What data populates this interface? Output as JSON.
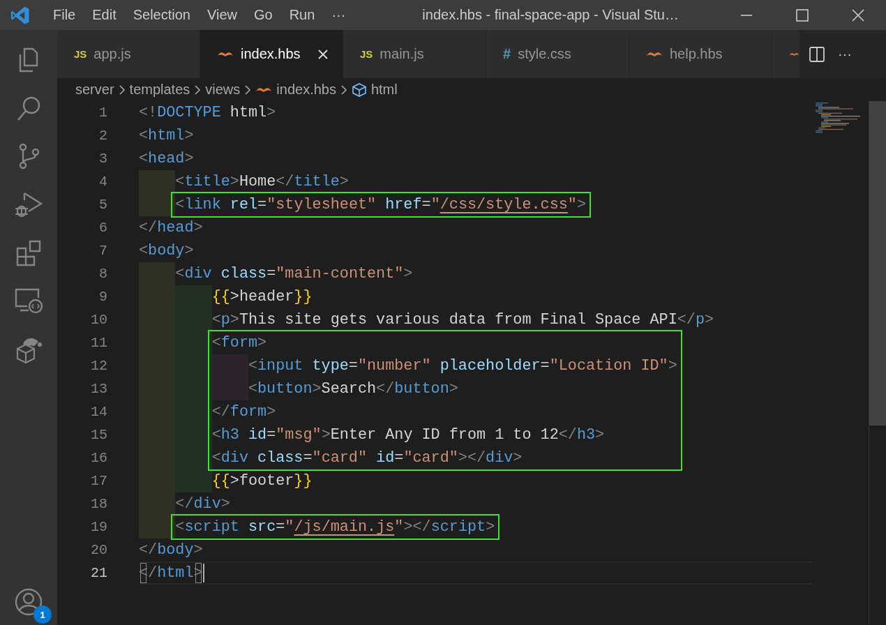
{
  "title_bar": {
    "menu": [
      "File",
      "Edit",
      "Selection",
      "View",
      "Go",
      "Run",
      "···"
    ],
    "title": "index.hbs - final-space-app - Visual Stu…"
  },
  "activity_bar": {
    "account_badge": "1"
  },
  "tabs": [
    {
      "kind": "js",
      "icon_text": "JS",
      "label": "app.js",
      "selected": false
    },
    {
      "kind": "hbs",
      "label": "index.hbs",
      "selected": true
    },
    {
      "kind": "js",
      "icon_text": "JS",
      "label": "main.js",
      "selected": false
    },
    {
      "kind": "css",
      "icon_text": "#",
      "label": "style.css",
      "selected": false
    },
    {
      "kind": "hbs",
      "label": "help.hbs",
      "selected": false
    },
    {
      "kind": "hbs",
      "selected": false
    }
  ],
  "tab_actions": {
    "more": "···"
  },
  "breadcrumbs": [
    {
      "kind": "folder",
      "label": "server"
    },
    {
      "kind": "folder",
      "label": "templates"
    },
    {
      "kind": "folder",
      "label": "views"
    },
    {
      "kind": "hbs",
      "label": "index.hbs"
    },
    {
      "kind": "element",
      "label": "html"
    }
  ],
  "code": [
    {
      "kind": "line",
      "number": "1",
      "current": false,
      "tokens": [
        {
          "kind": "punct",
          "text": "<!"
        },
        {
          "kind": "tag",
          "text": "DOCTYPE"
        },
        {
          "kind": "text",
          "text": " html"
        },
        {
          "kind": "punct",
          "text": ">"
        }
      ]
    },
    {
      "kind": "line",
      "number": "2",
      "current": false,
      "tokens": [
        {
          "kind": "punct",
          "text": "<"
        },
        {
          "kind": "tag",
          "text": "html"
        },
        {
          "kind": "punct",
          "text": ">"
        }
      ]
    },
    {
      "kind": "line",
      "number": "3",
      "current": false,
      "tokens": [
        {
          "kind": "punct",
          "text": "<"
        },
        {
          "kind": "tag",
          "text": "head"
        },
        {
          "kind": "punct",
          "text": ">"
        }
      ]
    },
    {
      "kind": "line",
      "number": "4",
      "current": false,
      "tokens": [
        {
          "kind": "punct",
          "text": "    <"
        },
        {
          "kind": "tag",
          "text": "title"
        },
        {
          "kind": "punct",
          "text": ">"
        },
        {
          "kind": "text",
          "text": "Home"
        },
        {
          "kind": "punct",
          "text": "</"
        },
        {
          "kind": "tag",
          "text": "title"
        },
        {
          "kind": "punct",
          "text": ">"
        }
      ]
    },
    {
      "kind": "box",
      "lines": [
        {
          "kind": "line",
          "number": "5",
          "current": false,
          "tokens": [
            {
              "kind": "punct",
              "text": "    <"
            },
            {
              "kind": "tag",
              "text": "link"
            },
            {
              "kind": "attr",
              "text": " rel"
            },
            {
              "kind": "text",
              "text": "="
            },
            {
              "kind": "str",
              "text": "\"stylesheet\""
            },
            {
              "kind": "attr",
              "text": " href"
            },
            {
              "kind": "text",
              "text": "="
            },
            {
              "kind": "str",
              "text": "\""
            },
            {
              "kind": "link",
              "text": "/css/style.css"
            },
            {
              "kind": "str",
              "text": "\""
            },
            {
              "kind": "punct",
              "text": ">"
            }
          ]
        }
      ]
    },
    {
      "kind": "line",
      "number": "6",
      "current": false,
      "tokens": [
        {
          "kind": "punct",
          "text": "</"
        },
        {
          "kind": "tag",
          "text": "head"
        },
        {
          "kind": "punct",
          "text": ">"
        }
      ]
    },
    {
      "kind": "line",
      "number": "7",
      "current": false,
      "tokens": [
        {
          "kind": "punct",
          "text": "<"
        },
        {
          "kind": "tag",
          "text": "body"
        },
        {
          "kind": "punct",
          "text": ">"
        }
      ]
    },
    {
      "kind": "line",
      "number": "8",
      "current": false,
      "tokens": [
        {
          "kind": "punct",
          "text": "    <"
        },
        {
          "kind": "tag",
          "text": "div"
        },
        {
          "kind": "attr",
          "text": " class"
        },
        {
          "kind": "text",
          "text": "="
        },
        {
          "kind": "str",
          "text": "\"main-content\""
        },
        {
          "kind": "punct",
          "text": ">"
        }
      ]
    },
    {
      "kind": "line",
      "number": "9",
      "current": false,
      "tokens": [
        {
          "kind": "hbs",
          "text": "        {{"
        },
        {
          "kind": "text",
          "text": ">header"
        },
        {
          "kind": "hbs",
          "text": "}}"
        }
      ]
    },
    {
      "kind": "line",
      "number": "10",
      "current": false,
      "tokens": [
        {
          "kind": "punct",
          "text": "        <"
        },
        {
          "kind": "tag",
          "text": "p"
        },
        {
          "kind": "punct",
          "text": ">"
        },
        {
          "kind": "text",
          "text": "This site gets various data from Final Space API"
        },
        {
          "kind": "punct",
          "text": "</"
        },
        {
          "kind": "tag",
          "text": "p"
        },
        {
          "kind": "punct",
          "text": ">"
        }
      ]
    },
    {
      "kind": "box",
      "lines": [
        {
          "kind": "line",
          "number": "11",
          "current": false,
          "tokens": [
            {
              "kind": "punct",
              "text": "        <"
            },
            {
              "kind": "tag",
              "text": "form"
            },
            {
              "kind": "punct",
              "text": ">"
            }
          ]
        },
        {
          "kind": "line",
          "number": "12",
          "current": false,
          "tokens": [
            {
              "kind": "punct",
              "text": "            <"
            },
            {
              "kind": "tag",
              "text": "input"
            },
            {
              "kind": "attr",
              "text": " type"
            },
            {
              "kind": "text",
              "text": "="
            },
            {
              "kind": "str",
              "text": "\"number\""
            },
            {
              "kind": "attr",
              "text": " placeholder"
            },
            {
              "kind": "text",
              "text": "="
            },
            {
              "kind": "str",
              "text": "\"Location ID\""
            },
            {
              "kind": "punct",
              "text": ">"
            }
          ]
        },
        {
          "kind": "line",
          "number": "13",
          "current": false,
          "tokens": [
            {
              "kind": "punct",
              "text": "            <"
            },
            {
              "kind": "tag",
              "text": "button"
            },
            {
              "kind": "punct",
              "text": ">"
            },
            {
              "kind": "text",
              "text": "Search"
            },
            {
              "kind": "punct",
              "text": "</"
            },
            {
              "kind": "tag",
              "text": "button"
            },
            {
              "kind": "punct",
              "text": ">"
            }
          ]
        },
        {
          "kind": "line",
          "number": "14",
          "current": false,
          "tokens": [
            {
              "kind": "punct",
              "text": "        </"
            },
            {
              "kind": "tag",
              "text": "form"
            },
            {
              "kind": "punct",
              "text": ">"
            }
          ]
        },
        {
          "kind": "line",
          "number": "15",
          "current": false,
          "tokens": [
            {
              "kind": "punct",
              "text": "        <"
            },
            {
              "kind": "tag",
              "text": "h3"
            },
            {
              "kind": "attr",
              "text": " id"
            },
            {
              "kind": "text",
              "text": "="
            },
            {
              "kind": "str",
              "text": "\"msg\""
            },
            {
              "kind": "punct",
              "text": ">"
            },
            {
              "kind": "text",
              "text": "Enter Any ID from 1 to 12"
            },
            {
              "kind": "punct",
              "text": "</"
            },
            {
              "kind": "tag",
              "text": "h3"
            },
            {
              "kind": "punct",
              "text": ">"
            }
          ]
        },
        {
          "kind": "line",
          "number": "16",
          "current": false,
          "tokens": [
            {
              "kind": "punct",
              "text": "        <"
            },
            {
              "kind": "tag",
              "text": "div"
            },
            {
              "kind": "attr",
              "text": " class"
            },
            {
              "kind": "text",
              "text": "="
            },
            {
              "kind": "str",
              "text": "\"card\""
            },
            {
              "kind": "attr",
              "text": " id"
            },
            {
              "kind": "text",
              "text": "="
            },
            {
              "kind": "str",
              "text": "\"card\""
            },
            {
              "kind": "punct",
              "text": "></"
            },
            {
              "kind": "tag",
              "text": "div"
            },
            {
              "kind": "punct",
              "text": ">"
            }
          ]
        }
      ]
    },
    {
      "kind": "line",
      "number": "17",
      "current": false,
      "tokens": [
        {
          "kind": "hbs",
          "text": "        {{"
        },
        {
          "kind": "text",
          "text": ">footer"
        },
        {
          "kind": "hbs",
          "text": "}}"
        }
      ]
    },
    {
      "kind": "line",
      "number": "18",
      "current": false,
      "tokens": [
        {
          "kind": "punct",
          "text": "    </"
        },
        {
          "kind": "tag",
          "text": "div"
        },
        {
          "kind": "punct",
          "text": ">"
        }
      ]
    },
    {
      "kind": "box",
      "lines": [
        {
          "kind": "line",
          "number": "19",
          "current": false,
          "tokens": [
            {
              "kind": "punct",
              "text": "    <"
            },
            {
              "kind": "tag",
              "text": "script"
            },
            {
              "kind": "attr",
              "text": " src"
            },
            {
              "kind": "text",
              "text": "="
            },
            {
              "kind": "str",
              "text": "\""
            },
            {
              "kind": "link",
              "text": "/js/main.js"
            },
            {
              "kind": "str",
              "text": "\""
            },
            {
              "kind": "punct",
              "text": "></"
            },
            {
              "kind": "tag",
              "text": "script"
            },
            {
              "kind": "punct",
              "text": ">"
            }
          ]
        }
      ]
    },
    {
      "kind": "line",
      "number": "20",
      "current": false,
      "tokens": [
        {
          "kind": "punct",
          "text": "</"
        },
        {
          "kind": "tag",
          "text": "body"
        },
        {
          "kind": "punct",
          "text": ">"
        }
      ]
    },
    {
      "kind": "line",
      "number": "21",
      "current": true,
      "tokens": [
        {
          "kind": "bracket",
          "text": "<"
        },
        {
          "kind": "punct",
          "text": "/"
        },
        {
          "kind": "tag",
          "text": "html"
        },
        {
          "kind": "bracket",
          "text": ">"
        }
      ]
    }
  ]
}
